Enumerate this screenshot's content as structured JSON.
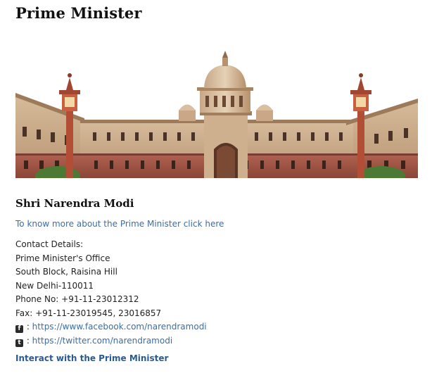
{
  "page": {
    "title": "Prime Minister"
  },
  "hero": {
    "alt": "Rashtrapati Bhavan / South Block building"
  },
  "pm": {
    "name": "Shri Narendra Modi",
    "more_link": "To know more about the Prime Minister click here"
  },
  "contact": {
    "heading": "Contact Details:",
    "office": "Prime Minister's Office",
    "address1": "South Block, Raisina Hill",
    "address2": "New Delhi-110011",
    "phone": "Phone No: +91-11-23012312",
    "fax": "Fax: +91-11-23019545, 23016857",
    "facebook_glyph": "f",
    "twitter_glyph": "t",
    "separator": " : ",
    "facebook_url": "https://www.facebook.com/narendramodi",
    "twitter_url": "https://twitter.com/narendramodi"
  },
  "interact_link": "Interact with the Prime Minister",
  "icons": {
    "facebook": "facebook-icon",
    "twitter": "twitter-icon"
  },
  "colors": {
    "link": "#3a6ea5",
    "interact": "#2d5a8e",
    "sky": "#ffffff",
    "sandstone": "#c9a98a",
    "red_sandstone": "#a85c4a"
  }
}
